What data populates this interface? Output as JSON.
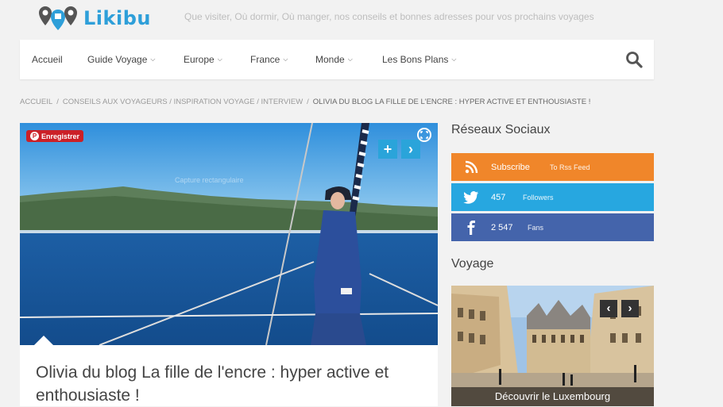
{
  "header": {
    "logo_text": "Likibu",
    "tagline": "Que visiter, Où dormir, Où manger, nos conseils et bonnes adresses pour vos prochains voyages"
  },
  "nav": {
    "items": [
      {
        "label": "Accueil"
      },
      {
        "label": "Guide Voyage"
      },
      {
        "label": "Europe"
      },
      {
        "label": "France"
      },
      {
        "label": "Monde"
      },
      {
        "label": "Les Bons Plans"
      }
    ]
  },
  "breadcrumb": {
    "items": [
      "Accueil",
      "Conseils aux voyageurs",
      "Inspiration voyage",
      "Interview"
    ],
    "current": "Olivia du blog La fille de l'encre : hyper active et enthousiaste !"
  },
  "article": {
    "save_label": "Enregistrer",
    "image_watermark": "Capture rectangulaire",
    "title": "Olivia du blog La fille de l'encre : hyper active et enthousiaste !"
  },
  "sidebar": {
    "social_title": "Réseaux Sociaux",
    "social": [
      {
        "main": "Subscribe",
        "sub": "To Rss Feed",
        "color": "#f0862a",
        "icon": "rss-icon"
      },
      {
        "main": "457",
        "sub": "Followers",
        "color": "#27a7e0",
        "icon": "twitter-icon"
      },
      {
        "main": "2 547",
        "sub": "Fans",
        "color": "#4464ab",
        "icon": "facebook-icon"
      }
    ],
    "voyage_title": "Voyage",
    "voyage_caption": "Découvrir le Luxembourg"
  }
}
